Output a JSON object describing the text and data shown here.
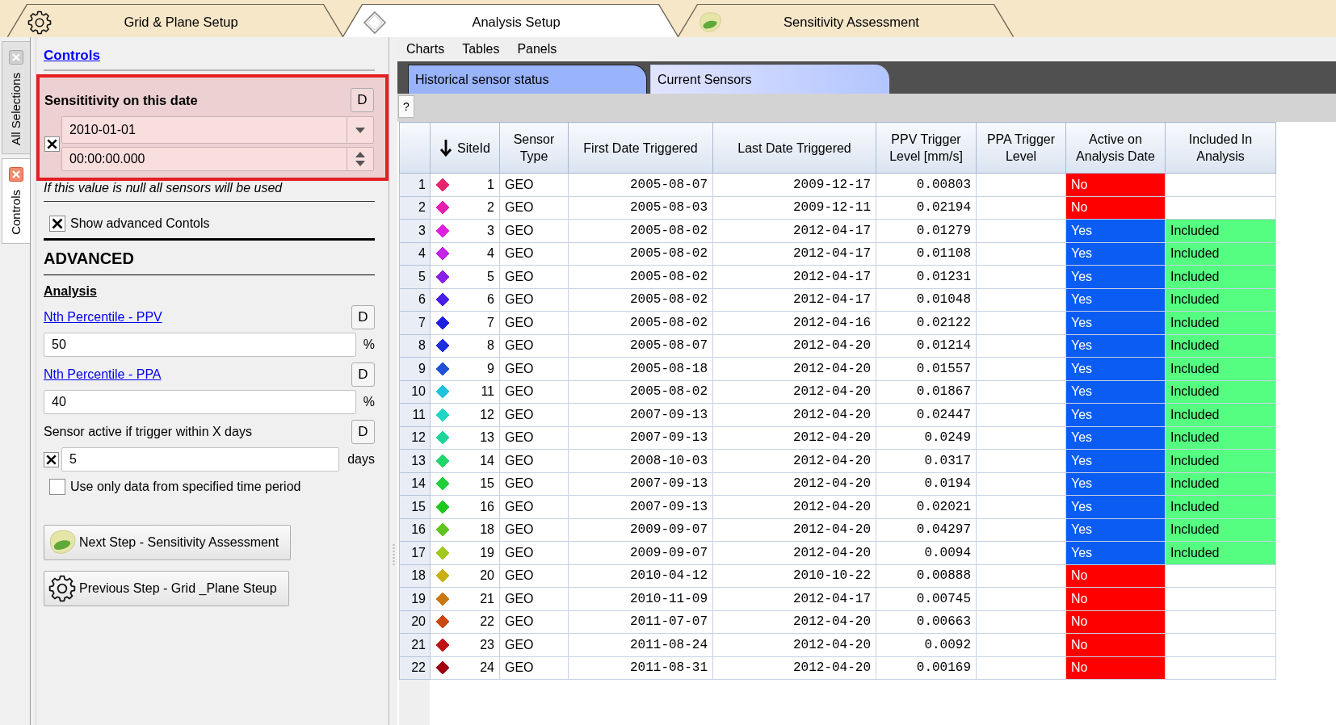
{
  "main_tabs": [
    {
      "label": "Grid & Plane Setup",
      "kind": "gear",
      "selected": false
    },
    {
      "label": "Analysis Setup",
      "kind": "diamond",
      "selected": true
    },
    {
      "label": "Sensitivity Assessment",
      "kind": "blob",
      "selected": false
    }
  ],
  "side_tabs": [
    {
      "label": "All Selections",
      "selected": false
    },
    {
      "label": "Controls",
      "selected": true
    }
  ],
  "controls_panel": {
    "title": "Controls",
    "date_filter": {
      "label": "Sensititivity on this date",
      "reset_button": "D",
      "highlighted": true,
      "enabled": true,
      "date": "2010-01-01",
      "time": "00:00:00.000"
    },
    "note": "If this value is null all sensors will be used",
    "show_advanced": {
      "label": "Show advanced Contols",
      "checked": true
    },
    "advanced_heading": "ADVANCED",
    "analysis_heading": "Analysis",
    "percentiles": [
      {
        "label": "Nth Percentile - PPV",
        "reset_button": "D",
        "value": "50",
        "unit": "%"
      },
      {
        "label": "Nth Percentile - PPA",
        "reset_button": "D",
        "value": "40",
        "unit": "%"
      }
    ],
    "active_window": {
      "label": "Sensor active if trigger within X days",
      "reset_button": "D",
      "checked": true,
      "value": "5",
      "unit": "days"
    },
    "time_period": {
      "label": "Use only data from specified time period",
      "checked": false
    },
    "step_buttons": [
      {
        "label": "Next Step - Sensitivity Assessment",
        "kind": "blob"
      },
      {
        "label": "Previous Step - Grid _Plane Steup",
        "kind": "gear"
      }
    ]
  },
  "menu": [
    "Charts",
    "Tables",
    "Panels"
  ],
  "view_tabs": [
    {
      "label": "Historical sensor status",
      "selected": true
    },
    {
      "label": "Current Sensors",
      "selected": false
    }
  ],
  "toolbar": {
    "help_button": "?"
  },
  "table": {
    "columns": [
      {
        "label": "SiteId",
        "sorted": true
      },
      {
        "label": "Sensor Type",
        "sorted": false
      },
      {
        "label": "First Date Triggered",
        "sorted": false
      },
      {
        "label": "Last Date Triggered",
        "sorted": false
      },
      {
        "label": "PPV Trigger Level [mm/s]",
        "sorted": false
      },
      {
        "label": "PPA Trigger Level",
        "sorted": false
      },
      {
        "label": "Active on Analysis Date",
        "sorted": false
      },
      {
        "label": "Included In Analysis",
        "sorted": false
      }
    ],
    "rows": [
      {
        "row": "1",
        "color": "#e8246e",
        "site_id": "1",
        "sensor_type": "GEO",
        "first_date": "2005-08-07",
        "last_date": "2009-12-17",
        "ppv_level": "0.00803",
        "active": false,
        "active_text": "No",
        "included": false
      },
      {
        "row": "2",
        "color": "#e61fb0",
        "site_id": "2",
        "sensor_type": "GEO",
        "first_date": "2005-08-03",
        "last_date": "2009-12-11",
        "ppv_level": "0.02194",
        "active": false,
        "active_text": "No",
        "included": false
      },
      {
        "row": "3",
        "color": "#e020e0",
        "site_id": "3",
        "sensor_type": "GEO",
        "first_date": "2005-08-02",
        "last_date": "2012-04-17",
        "ppv_level": "0.01279",
        "active": true,
        "active_text": "Yes",
        "included": true,
        "included_text": "Included"
      },
      {
        "row": "4",
        "color": "#c424e6",
        "site_id": "4",
        "sensor_type": "GEO",
        "first_date": "2005-08-02",
        "last_date": "2012-04-17",
        "ppv_level": "0.01108",
        "active": true,
        "active_text": "Yes",
        "included": true,
        "included_text": "Included"
      },
      {
        "row": "5",
        "color": "#8a1fe6",
        "site_id": "5",
        "sensor_type": "GEO",
        "first_date": "2005-08-02",
        "last_date": "2012-04-17",
        "ppv_level": "0.01231",
        "active": true,
        "active_text": "Yes",
        "included": true,
        "included_text": "Included"
      },
      {
        "row": "6",
        "color": "#4a1fe6",
        "site_id": "6",
        "sensor_type": "GEO",
        "first_date": "2005-08-02",
        "last_date": "2012-04-17",
        "ppv_level": "0.01048",
        "active": true,
        "active_text": "Yes",
        "included": true,
        "included_text": "Included"
      },
      {
        "row": "7",
        "color": "#1f1fe0",
        "site_id": "7",
        "sensor_type": "GEO",
        "first_date": "2005-08-02",
        "last_date": "2012-04-16",
        "ppv_level": "0.02122",
        "active": true,
        "active_text": "Yes",
        "included": true,
        "included_text": "Included"
      },
      {
        "row": "8",
        "color": "#1f2fe0",
        "site_id": "8",
        "sensor_type": "GEO",
        "first_date": "2005-08-07",
        "last_date": "2012-04-20",
        "ppv_level": "0.01214",
        "active": true,
        "active_text": "Yes",
        "included": true,
        "included_text": "Included"
      },
      {
        "row": "9",
        "color": "#1f50d6",
        "site_id": "9",
        "sensor_type": "GEO",
        "first_date": "2005-08-18",
        "last_date": "2012-04-20",
        "ppv_level": "0.01557",
        "active": true,
        "active_text": "Yes",
        "included": true,
        "included_text": "Included"
      },
      {
        "row": "10",
        "color": "#1fc4dc",
        "site_id": "11",
        "sensor_type": "GEO",
        "first_date": "2005-08-02",
        "last_date": "2012-04-20",
        "ppv_level": "0.01867",
        "active": true,
        "active_text": "Yes",
        "included": true,
        "included_text": "Included"
      },
      {
        "row": "11",
        "color": "#1fd6c4",
        "site_id": "12",
        "sensor_type": "GEO",
        "first_date": "2007-09-13",
        "last_date": "2012-04-20",
        "ppv_level": "0.02447",
        "active": true,
        "active_text": "Yes",
        "included": true,
        "included_text": "Included"
      },
      {
        "row": "12",
        "color": "#1fd69a",
        "site_id": "13",
        "sensor_type": "GEO",
        "first_date": "2007-09-13",
        "last_date": "2012-04-20",
        "ppv_level": "0.0249",
        "active": true,
        "active_text": "Yes",
        "included": true,
        "included_text": "Included"
      },
      {
        "row": "13",
        "color": "#1fd66a",
        "site_id": "14",
        "sensor_type": "GEO",
        "first_date": "2008-10-03",
        "last_date": "2012-04-20",
        "ppv_level": "0.0317",
        "active": true,
        "active_text": "Yes",
        "included": true,
        "included_text": "Included"
      },
      {
        "row": "14",
        "color": "#1fd03a",
        "site_id": "15",
        "sensor_type": "GEO",
        "first_date": "2007-09-13",
        "last_date": "2012-04-20",
        "ppv_level": "0.0194",
        "active": true,
        "active_text": "Yes",
        "included": true,
        "included_text": "Included"
      },
      {
        "row": "15",
        "color": "#1fc81f",
        "site_id": "16",
        "sensor_type": "GEO",
        "first_date": "2007-09-13",
        "last_date": "2012-04-20",
        "ppv_level": "0.02021",
        "active": true,
        "active_text": "Yes",
        "included": true,
        "included_text": "Included"
      },
      {
        "row": "16",
        "color": "#62c41f",
        "site_id": "18",
        "sensor_type": "GEO",
        "first_date": "2009-09-07",
        "last_date": "2012-04-20",
        "ppv_level": "0.04297",
        "active": true,
        "active_text": "Yes",
        "included": true,
        "included_text": "Included"
      },
      {
        "row": "17",
        "color": "#a2c81f",
        "site_id": "19",
        "sensor_type": "GEO",
        "first_date": "2009-09-07",
        "last_date": "2012-04-20",
        "ppv_level": "0.0094",
        "active": true,
        "active_text": "Yes",
        "included": true,
        "included_text": "Included"
      },
      {
        "row": "18",
        "color": "#c8b00f",
        "site_id": "20",
        "sensor_type": "GEO",
        "first_date": "2010-04-12",
        "last_date": "2010-10-22",
        "ppv_level": "0.00888",
        "active": false,
        "active_text": "No",
        "included": false
      },
      {
        "row": "19",
        "color": "#c8780f",
        "site_id": "21",
        "sensor_type": "GEO",
        "first_date": "2010-11-09",
        "last_date": "2012-04-17",
        "ppv_level": "0.00745",
        "active": false,
        "active_text": "No",
        "included": false
      },
      {
        "row": "20",
        "color": "#c8480f",
        "site_id": "22",
        "sensor_type": "GEO",
        "first_date": "2011-07-07",
        "last_date": "2012-04-20",
        "ppv_level": "0.00663",
        "active": false,
        "active_text": "No",
        "included": false
      },
      {
        "row": "21",
        "color": "#c01414",
        "site_id": "23",
        "sensor_type": "GEO",
        "first_date": "2011-08-24",
        "last_date": "2012-04-20",
        "ppv_level": "0.0092",
        "active": false,
        "active_text": "No",
        "included": false
      },
      {
        "row": "22",
        "color": "#a00010",
        "site_id": "24",
        "sensor_type": "GEO",
        "first_date": "2011-08-31",
        "last_date": "2012-04-20",
        "ppv_level": "0.00169",
        "active": false,
        "active_text": "No",
        "included": false
      }
    ]
  }
}
